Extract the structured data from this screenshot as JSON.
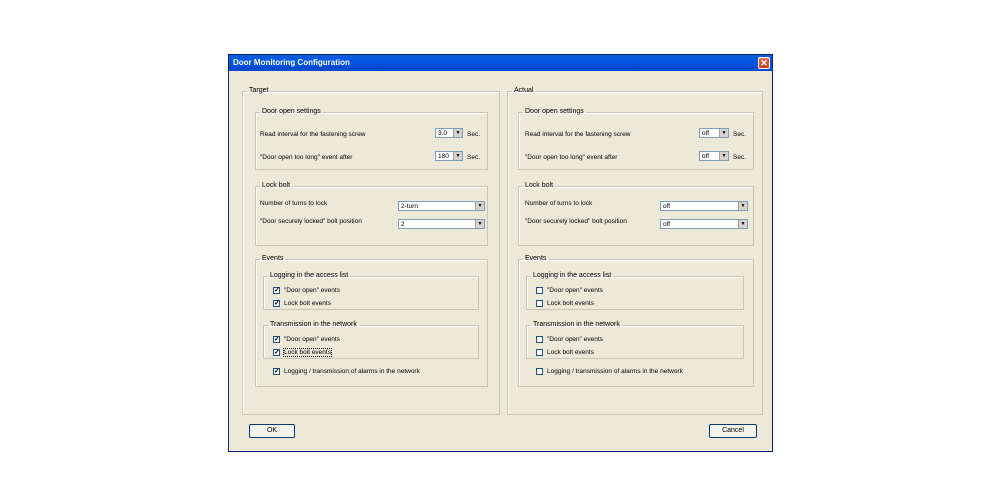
{
  "window": {
    "title": "Door Monitoring Configuration",
    "close_glyph": "✕"
  },
  "panels": [
    {
      "title": "Target",
      "door_open": {
        "title": "Door open settings",
        "read_interval_label": "Read interval for the fastening screw",
        "read_interval_value": "3.0",
        "event_after_label": "\"Door open too long\" event after",
        "event_after_value": "180",
        "unit": "Sec."
      },
      "lock_bolt": {
        "title": "Lock bolt",
        "turns_label": "Number of turns to lock",
        "turns_value": "2-turn",
        "position_label": "\"Door securely locked\" bolt position",
        "position_value": "2"
      },
      "events": {
        "title": "Events",
        "logging": {
          "title": "Logging in the access list",
          "door_open": "\"Door open\" events",
          "lock_bolt": "Lock bolt events",
          "door_open_checked": true,
          "lock_bolt_checked": true
        },
        "transmission": {
          "title": "Transmission in the network",
          "door_open": "\"Door open\" events",
          "lock_bolt": "Lock bolt events",
          "door_open_checked": true,
          "lock_bolt_checked": true
        },
        "alarms_label": "Logging / transmission of alarms in the network",
        "alarms_checked": true
      }
    },
    {
      "title": "Actual",
      "door_open": {
        "title": "Door open settings",
        "read_interval_label": "Read interval for the fastening screw",
        "read_interval_value": "off",
        "event_after_label": "\"Door open too long\" event after",
        "event_after_value": "off",
        "unit": "Sec."
      },
      "lock_bolt": {
        "title": "Lock bolt",
        "turns_label": "Number of turns to lock",
        "turns_value": "off",
        "position_label": "\"Door securely locked\" bolt position",
        "position_value": "off"
      },
      "events": {
        "title": "Events",
        "logging": {
          "title": "Logging in the access list",
          "door_open": "\"Door open\" events",
          "lock_bolt": "Lock bolt events",
          "door_open_checked": false,
          "lock_bolt_checked": false
        },
        "transmission": {
          "title": "Transmission in the network",
          "door_open": "\"Door open\" events",
          "lock_bolt": "Lock bolt events",
          "door_open_checked": false,
          "lock_bolt_checked": false
        },
        "alarms_label": "Logging / transmission of alarms in the network",
        "alarms_checked": false
      }
    }
  ],
  "buttons": {
    "ok": "OK",
    "cancel": "Cancel"
  },
  "icons": {
    "dropdown": "dropdown-arrow-icon",
    "check": "checkmark-icon",
    "close": "close-icon"
  },
  "colors": {
    "titlebar": "#0054E3",
    "dialog_bg": "#ECE9D8",
    "close": "#C6391B"
  }
}
